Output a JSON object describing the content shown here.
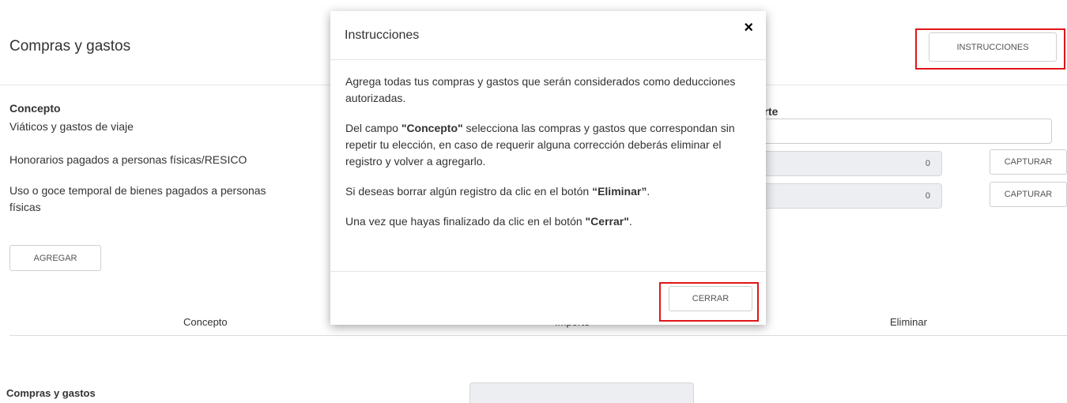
{
  "header": {
    "title": "Compras y gastos",
    "instructions_button": "INSTRUCCIONES"
  },
  "form": {
    "concepto_header": "Concepto",
    "importe_header_partial": "orte",
    "items": [
      {
        "label": "Viáticos y gastos de viaje"
      },
      {
        "label": "Honorarios pagados a personas físicas/RESICO",
        "value": "0",
        "button": "CAPTURAR"
      },
      {
        "label": "Uso o goce temporal de bienes pagados a personas físicas",
        "value": "0",
        "button": "CAPTURAR"
      }
    ],
    "add_button": "AGREGAR"
  },
  "table": {
    "headers": [
      "Concepto",
      "Importe",
      "Eliminar"
    ]
  },
  "summary": {
    "label": "Compras y gastos"
  },
  "modal": {
    "title": "Instrucciones",
    "close_glyph": "×",
    "p1": "Agrega todas tus compras y gastos que serán considerados como deducciones autorizadas.",
    "p2_pre": "Del campo ",
    "p2_bold": "\"Concepto\"",
    "p2_post": " selecciona las compras y gastos que correspondan sin repetir tu elección, en caso de requerir alguna corrección deberás eliminar el registro y volver a agregarlo.",
    "p3_pre": "Si deseas borrar algún registro da clic en el botón ",
    "p3_bold": "“Eliminar”",
    "p3_post": ".",
    "p4_pre": "Una vez que hayas finalizado da clic en el botón ",
    "p4_bold": "\"Cerrar\"",
    "p4_post": ".",
    "close_button": "CERRAR"
  },
  "colors": {
    "highlight": "#e0151a",
    "disabled_input": "#eceef1"
  }
}
